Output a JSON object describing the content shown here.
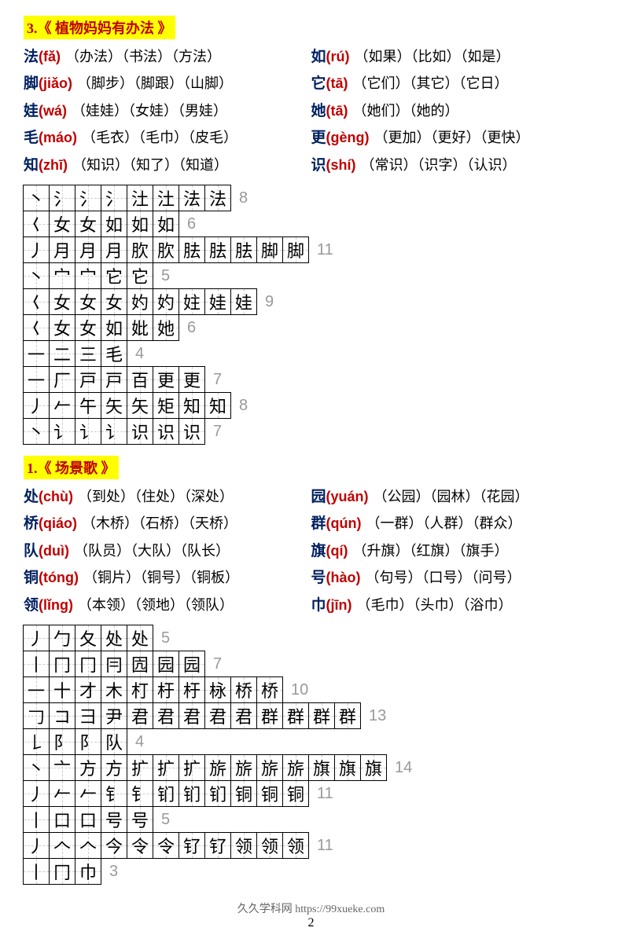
{
  "section1": {
    "title": "3.《 植物妈妈有办法 》",
    "vocab": [
      {
        "l": {
          "char": "法",
          "pinyin": "(fǎ)",
          "words": "（办法）（书法）（方法）"
        },
        "r": {
          "char": "如",
          "pinyin": "(rú)",
          "words": "（如果）（比如）（如是）"
        }
      },
      {
        "l": {
          "char": "脚",
          "pinyin": "(jiǎo)",
          "words": "（脚步）（脚跟）（山脚）"
        },
        "r": {
          "char": "它",
          "pinyin": "(tā)",
          "words": "（它们）（其它）（它日）"
        }
      },
      {
        "l": {
          "char": "娃",
          "pinyin": "(wá)",
          "words": "（娃娃）（女娃）（男娃）"
        },
        "r": {
          "char": "她",
          "pinyin": "(tā)",
          "words": "（她们）（她的）"
        }
      },
      {
        "l": {
          "char": "毛",
          "pinyin": "(máo)",
          "words": "（毛衣）（毛巾）（皮毛）"
        },
        "r": {
          "char": "更",
          "pinyin": "(gèng)",
          "words": "（更加）（更好）（更快）"
        }
      },
      {
        "l": {
          "char": "知",
          "pinyin": "(zhī)",
          "words": "（知识）（知了）（知道）"
        },
        "r": {
          "char": "识",
          "pinyin": "(shí)",
          "words": "（常识）（识字）（认识）"
        }
      }
    ],
    "strokes": [
      {
        "cells": [
          "丶",
          "氵",
          "氵",
          "氵",
          "汢",
          "汢",
          "法",
          "法"
        ],
        "count": 8
      },
      {
        "cells": [
          "𡿨",
          "女",
          "女",
          "如",
          "如",
          "如"
        ],
        "count": 6
      },
      {
        "cells": [
          "丿",
          "月",
          "月",
          "月",
          "肷",
          "肷",
          "胠",
          "胠",
          "胠",
          "脚",
          "脚"
        ],
        "count": 11
      },
      {
        "cells": [
          "丶",
          "宀",
          "宀",
          "它",
          "它"
        ],
        "count": 5
      },
      {
        "cells": [
          "𡿨",
          "女",
          "女",
          "女",
          "妁",
          "妁",
          "妵",
          "娃",
          "娃"
        ],
        "count": 9
      },
      {
        "cells": [
          "𡿨",
          "女",
          "女",
          "如",
          "妣",
          "她"
        ],
        "count": 6
      },
      {
        "cells": [
          "一",
          "二",
          "三",
          "毛"
        ],
        "count": 4
      },
      {
        "cells": [
          "一",
          "厂",
          "戸",
          "戸",
          "百",
          "更",
          "更"
        ],
        "count": 7
      },
      {
        "cells": [
          "丿",
          "𠂉",
          "午",
          "矢",
          "矢",
          "矩",
          "知",
          "知"
        ],
        "count": 8
      },
      {
        "cells": [
          "丶",
          "讠",
          "讠",
          "讠",
          "识",
          "识",
          "识"
        ],
        "count": 7
      }
    ]
  },
  "section2": {
    "title": "1.《 场景歌 》",
    "vocab": [
      {
        "l": {
          "char": "处",
          "pinyin": "(chù)",
          "words": "（到处）（住处）（深处）"
        },
        "r": {
          "char": "园",
          "pinyin": "(yuán)",
          "words": "（公园）（园林）（花园）"
        }
      },
      {
        "l": {
          "char": "桥",
          "pinyin": "(qiáo)",
          "words": "（木桥）（石桥）（天桥）"
        },
        "r": {
          "char": "群",
          "pinyin": "(qún)",
          "words": "（一群）（人群）（群众）"
        }
      },
      {
        "l": {
          "char": "队",
          "pinyin": "(duì)",
          "words": "（队员）（大队）（队长）"
        },
        "r": {
          "char": "旗",
          "pinyin": "(qí)",
          "words": "（升旗）（红旗）（旗手）"
        }
      },
      {
        "l": {
          "char": "铜",
          "pinyin": "(tóng)",
          "words": "（铜片）（铜号）（铜板）"
        },
        "r": {
          "char": "号",
          "pinyin": "(hào)",
          "words": "（句号）（口号）（问号）"
        }
      },
      {
        "l": {
          "char": "领",
          "pinyin": "(lǐng)",
          "words": "（本领）（领地）（领队）"
        },
        "r": {
          "char": "巾",
          "pinyin": " (jīn)",
          "words": "（毛巾）（头巾）（浴巾）"
        }
      }
    ],
    "strokes": [
      {
        "cells": [
          "丿",
          "勹",
          "夂",
          "处",
          "处"
        ],
        "count": 5
      },
      {
        "cells": [
          "丨",
          "冂",
          "冂",
          "冃",
          "囥",
          "园",
          "园"
        ],
        "count": 7
      },
      {
        "cells": [
          "一",
          "十",
          "才",
          "木",
          "朾",
          "杅",
          "杅",
          "栐",
          "桥",
          "桥"
        ],
        "count": 10
      },
      {
        "cells": [
          "𠃌",
          "コ",
          "彐",
          "尹",
          "君",
          "君",
          "君",
          "君",
          "君",
          "群",
          "群",
          "群",
          "群"
        ],
        "count": 13
      },
      {
        "cells": [
          "𠄌",
          "阝",
          "阝",
          "队"
        ],
        "count": 4
      },
      {
        "cells": [
          "丶",
          "亠",
          "方",
          "方",
          "扩",
          "扩",
          "扩",
          "旂",
          "旂",
          "旂",
          "旂",
          "旗",
          "旗",
          "旗"
        ],
        "count": 14
      },
      {
        "cells": [
          "丿",
          "𠂉",
          "𠂉",
          "钅",
          "钅",
          "钔",
          "钔",
          "钔",
          "铜",
          "铜",
          "铜"
        ],
        "count": 11
      },
      {
        "cells": [
          "丨",
          "口",
          "口",
          "号",
          "号"
        ],
        "count": 5
      },
      {
        "cells": [
          "丿",
          "𠆢",
          "𠆢",
          "今",
          "令",
          "令",
          "钌",
          "钌",
          "领",
          "领",
          "领"
        ],
        "count": 11
      },
      {
        "cells": [
          "丨",
          "冂",
          "巾"
        ],
        "count": 3
      }
    ]
  },
  "footer": "久久学科网 https://99xueke.com",
  "page": "2"
}
